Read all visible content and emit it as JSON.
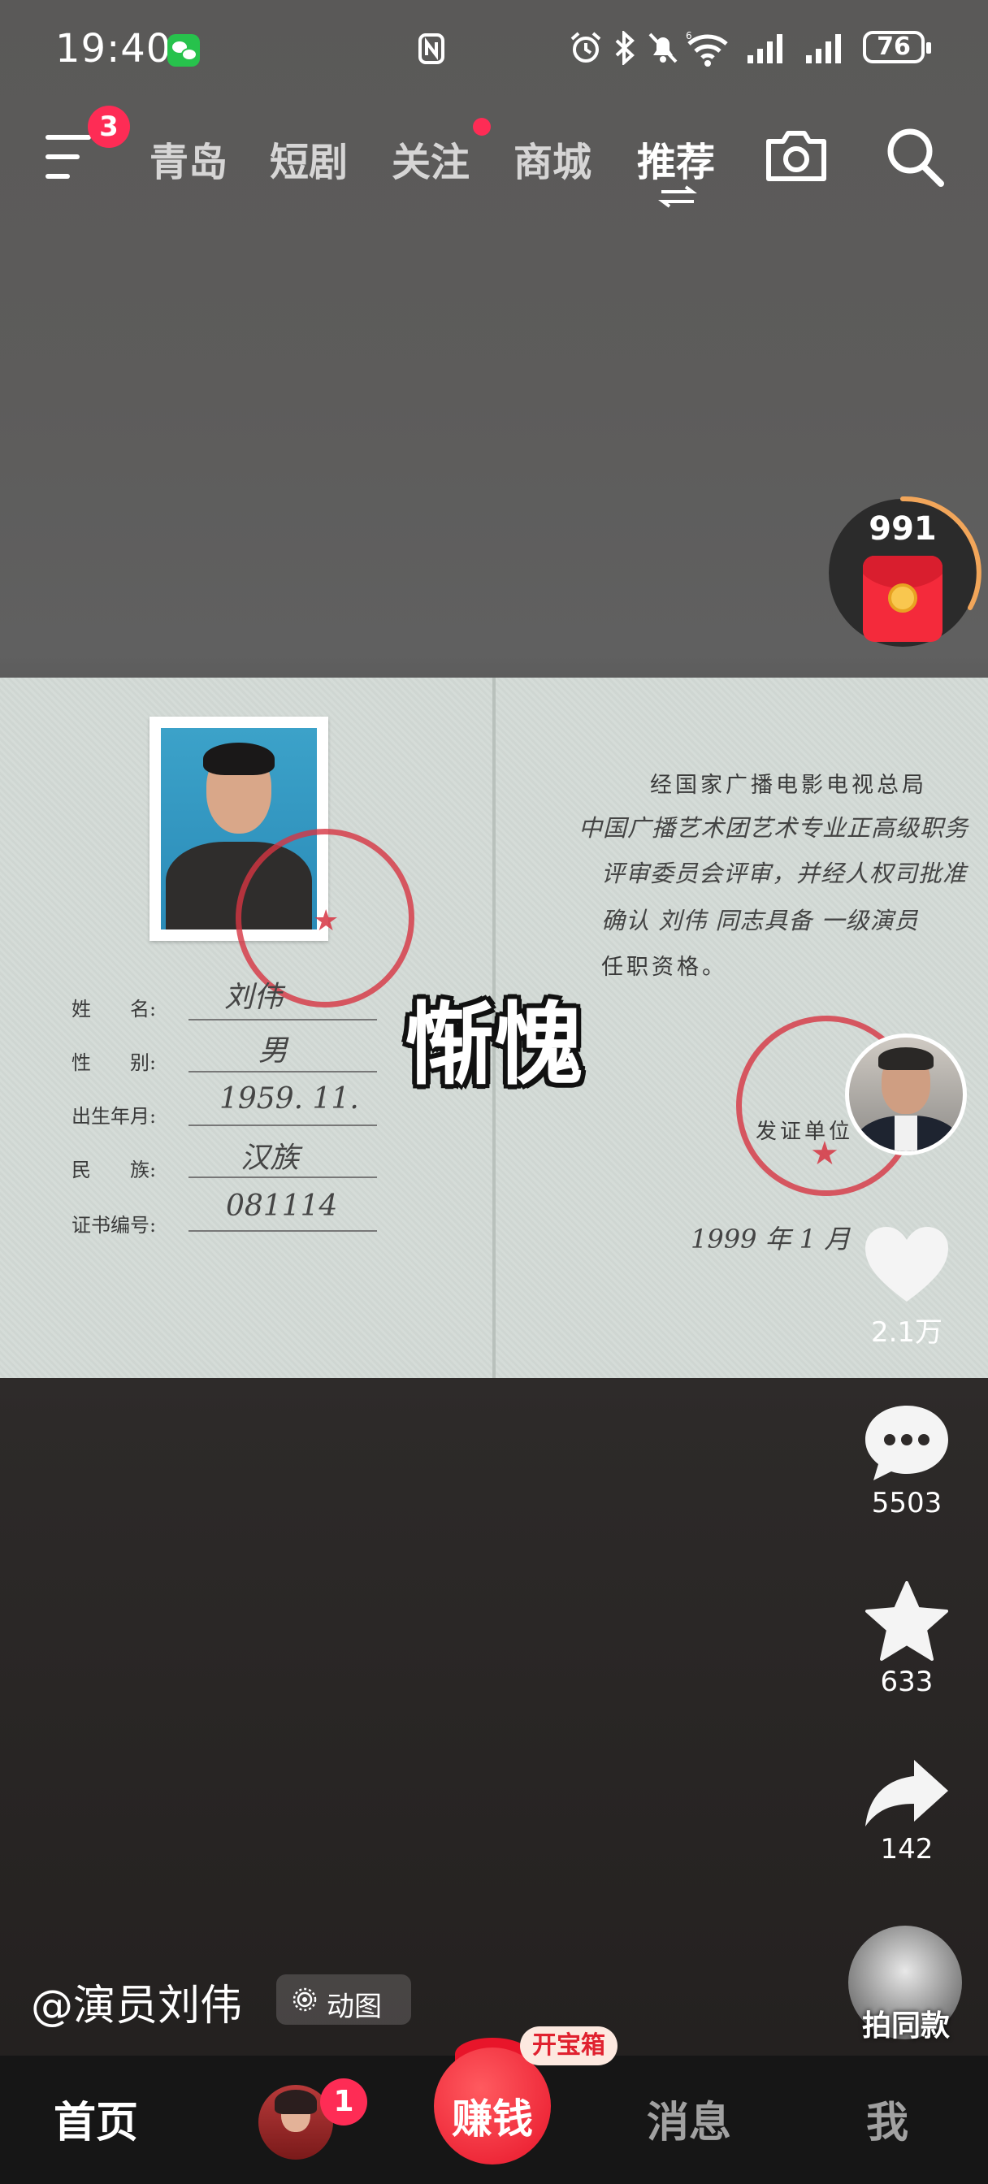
{
  "status_bar": {
    "time": "19:40",
    "battery": "76",
    "icons": [
      "wechat-icon",
      "nfc-icon",
      "alarm-icon",
      "bluetooth-icon",
      "mute-icon",
      "wifi-icon",
      "signal-icon",
      "signal-icon-2",
      "battery-icon"
    ]
  },
  "top_nav": {
    "menu_badge": "3",
    "tabs": [
      {
        "label": "青岛",
        "active": false
      },
      {
        "label": "短剧",
        "active": false
      },
      {
        "label": "关注",
        "active": false,
        "dot": true
      },
      {
        "label": "商城",
        "active": false
      },
      {
        "label": "推荐",
        "active": true
      }
    ]
  },
  "coin_widget": {
    "count": "991"
  },
  "certificate": {
    "caption": "惭愧",
    "left_fields": [
      {
        "label": "姓　　名:",
        "value": "刘伟"
      },
      {
        "label": "性　　别:",
        "value": "男"
      },
      {
        "label": "出生年月:",
        "value": "1959. 11."
      },
      {
        "label": "民　　族:",
        "value": "汉族"
      },
      {
        "label": "证书编号:",
        "value": "081114"
      }
    ],
    "right_lines": [
      "经国家广播电影电视总局",
      "中国广播艺术团艺术专业正高级职务",
      "评审委员会评审，并经人权司批准",
      "确认  刘伟  同志具备  一级演员",
      "任职资格。"
    ],
    "issuer_label": "发证单位",
    "date": "1999 年  1  月"
  },
  "actions": {
    "likes": "2.1万",
    "comments": "5503",
    "favorites": "633",
    "shares": "142"
  },
  "author": {
    "handle": "@演员刘伟",
    "tag": "动图"
  },
  "same_style": {
    "label": "拍同款"
  },
  "tab_bar": {
    "home": "首页",
    "friends_badge": "1",
    "earn": "赚钱",
    "treasure": "开宝箱",
    "messages": "消息",
    "me": "我"
  },
  "colors": {
    "accent": "#fe2c55",
    "stamp_red": "#d63442",
    "tab_bar_bg": "#161616"
  }
}
